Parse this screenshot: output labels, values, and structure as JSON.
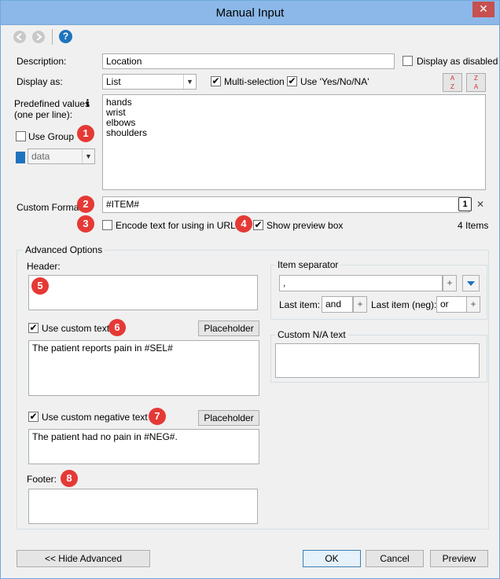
{
  "window": {
    "title": "Manual Input",
    "close_glyph": "✕"
  },
  "toolbar": {
    "back_icon": "back-icon",
    "forward_icon": "forward-icon",
    "help_icon": "help-icon",
    "help_glyph": "?"
  },
  "description": {
    "label": "Description:",
    "value": "Location",
    "display_disabled_label": "Display as disabled"
  },
  "display_as": {
    "label": "Display as:",
    "value": "List",
    "multi_selection_label": "Multi-selection",
    "multi_selection_checked": true,
    "yes_no_label": "Use 'Yes/No/NA'",
    "yes_no_checked": true
  },
  "predefined": {
    "label_line1": "Predefined values",
    "label_line2": "(one per line):",
    "values_text": "hands\nwrist\nelbows\nshoulders",
    "use_group_label": "Use Group",
    "group_value": "data"
  },
  "custom_format": {
    "label": "Custom Format:",
    "value": "#ITEM#",
    "count_button": "1",
    "clear_glyph": "✕"
  },
  "encode": {
    "label": "Encode text for using in URLs"
  },
  "preview_box": {
    "label": "Show preview box",
    "items_count": "4 Items"
  },
  "advanced": {
    "title": "Advanced Options",
    "header_label": "Header:",
    "use_custom_text_label": "Use custom text",
    "placeholder_button": "Placeholder",
    "custom_text_value": "The patient reports pain in  #SEL#",
    "use_custom_negative_label": "Use custom negative text",
    "custom_negative_value": "The patient had no pain in #NEG#.",
    "footer_label": "Footer:",
    "separator": {
      "title": "Item separator",
      "value": ",",
      "last_item_label": "Last item:",
      "last_item_value": "and",
      "last_item_neg_label": "Last item (neg):",
      "last_item_neg_value": "or"
    },
    "na_text": {
      "title": "Custom N/A text"
    }
  },
  "badges": [
    "1",
    "2",
    "3",
    "4",
    "5",
    "6",
    "7",
    "8"
  ],
  "buttons": {
    "hide_advanced": "<< Hide Advanced",
    "ok": "OK",
    "cancel": "Cancel",
    "preview": "Preview"
  },
  "colors": {
    "titlebar": "#8bb8e8",
    "badge": "#e53935",
    "help": "#1e73be"
  }
}
